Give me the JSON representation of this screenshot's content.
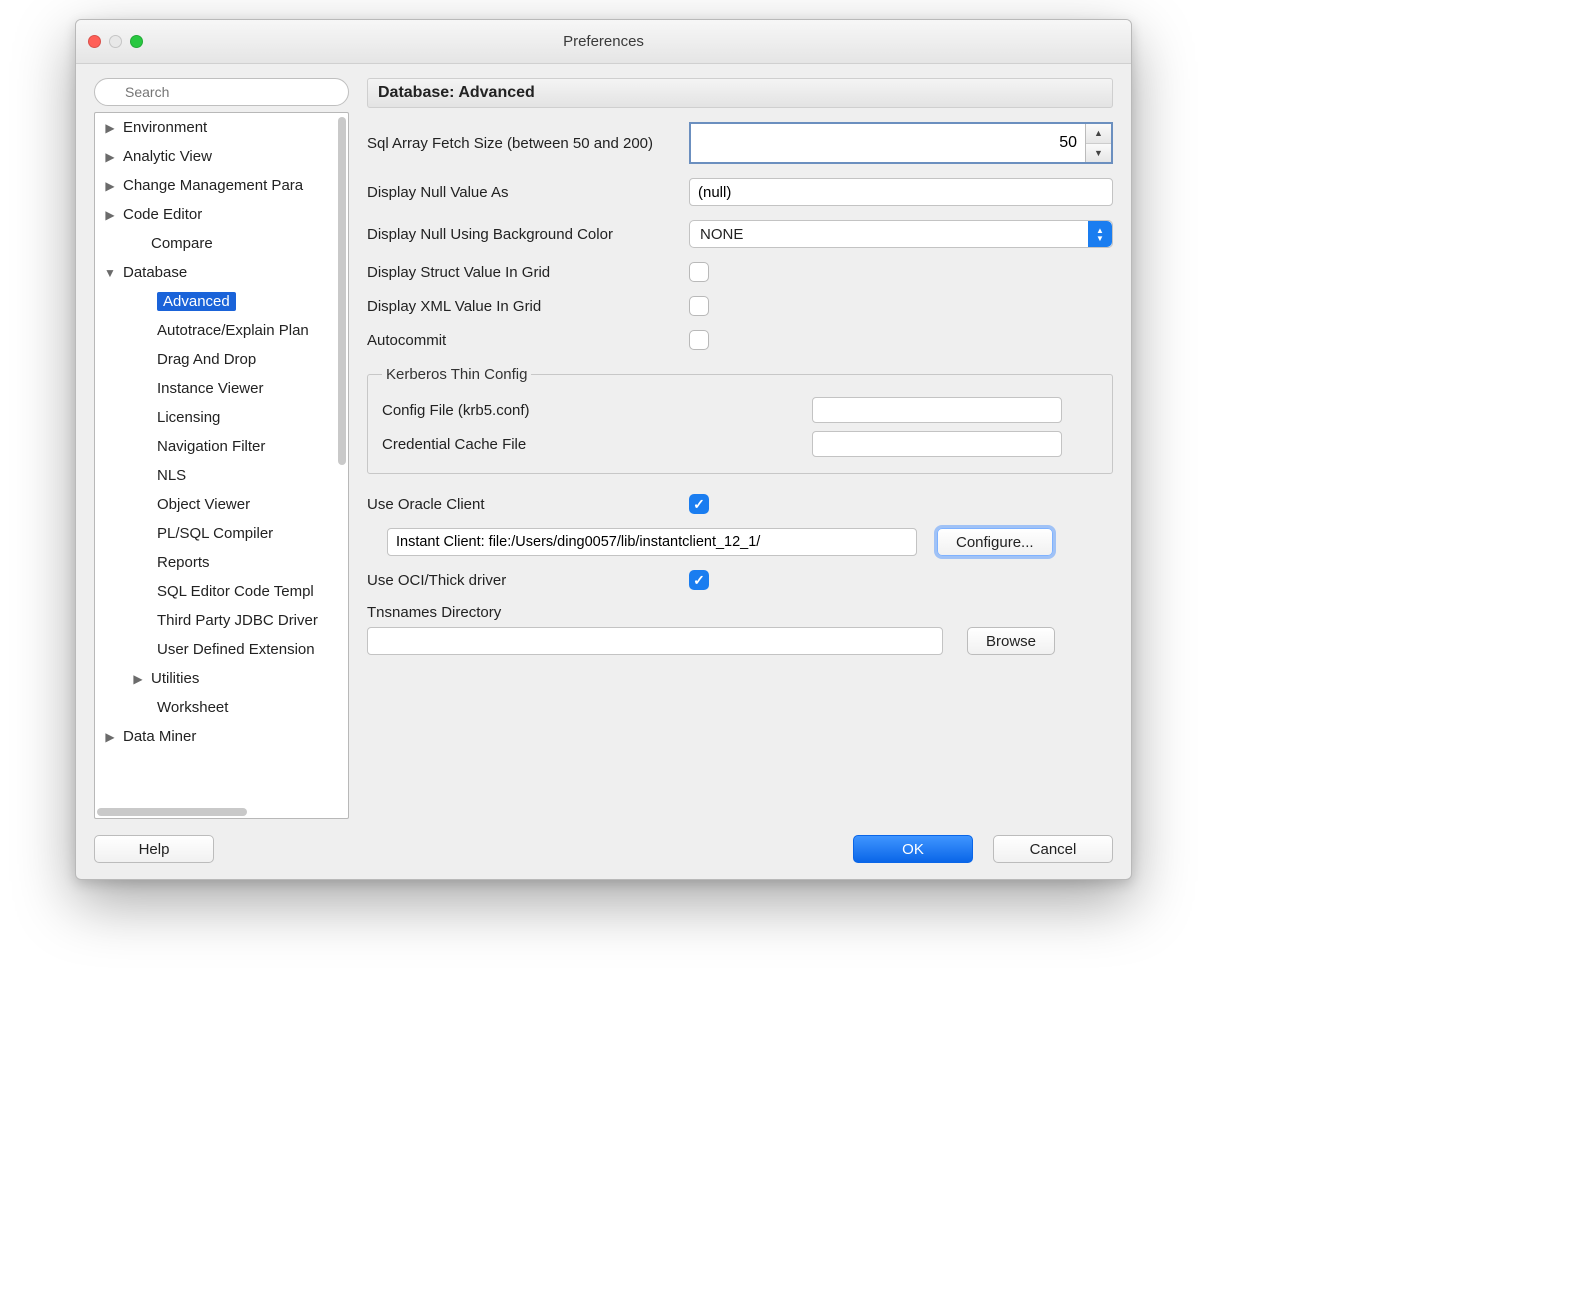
{
  "window": {
    "title": "Preferences"
  },
  "search": {
    "placeholder": "Search"
  },
  "tree": [
    "Environment",
    "Analytic View",
    "Change Management Para",
    "Code Editor",
    "Compare",
    "Database",
    "Advanced",
    "Autotrace/Explain Plan",
    "Drag And Drop",
    "Instance Viewer",
    "Licensing",
    "Navigation Filter",
    "NLS",
    "Object Viewer",
    "PL/SQL Compiler",
    "Reports",
    "SQL Editor Code Templ",
    "Third Party JDBC Driver",
    "User Defined Extension",
    "Utilities",
    "Worksheet",
    "Data Miner"
  ],
  "panel": {
    "heading": "Database: Advanced",
    "fields": {
      "fetch_size": {
        "label": "Sql Array Fetch Size (between 50 and 200)",
        "value": "50"
      },
      "null_value": {
        "label": "Display Null Value As",
        "value": "(null)"
      },
      "null_bg": {
        "label": "Display Null Using Background Color",
        "value": "NONE"
      },
      "struct_grid": {
        "label": "Display Struct Value In Grid",
        "checked": false
      },
      "xml_grid": {
        "label": "Display XML Value In Grid",
        "checked": false
      },
      "autocommit": {
        "label": "Autocommit",
        "checked": false
      },
      "use_oracle_client": {
        "label": "Use Oracle Client",
        "checked": true
      },
      "oracle_client_path": {
        "value": "Instant Client: file:/Users/ding0057/lib/instantclient_12_1/"
      },
      "use_oci": {
        "label": "Use OCI/Thick driver",
        "checked": true
      },
      "tnsnames": {
        "label": "Tnsnames Directory",
        "value": ""
      }
    },
    "kerberos": {
      "legend": "Kerberos Thin Config",
      "config_label": "Config File (krb5.conf)",
      "config_value": "",
      "cache_label": "Credential Cache File",
      "cache_value": ""
    },
    "buttons": {
      "configure": "Configure...",
      "browse": "Browse"
    }
  },
  "footer": {
    "help": "Help",
    "ok": "OK",
    "cancel": "Cancel"
  }
}
